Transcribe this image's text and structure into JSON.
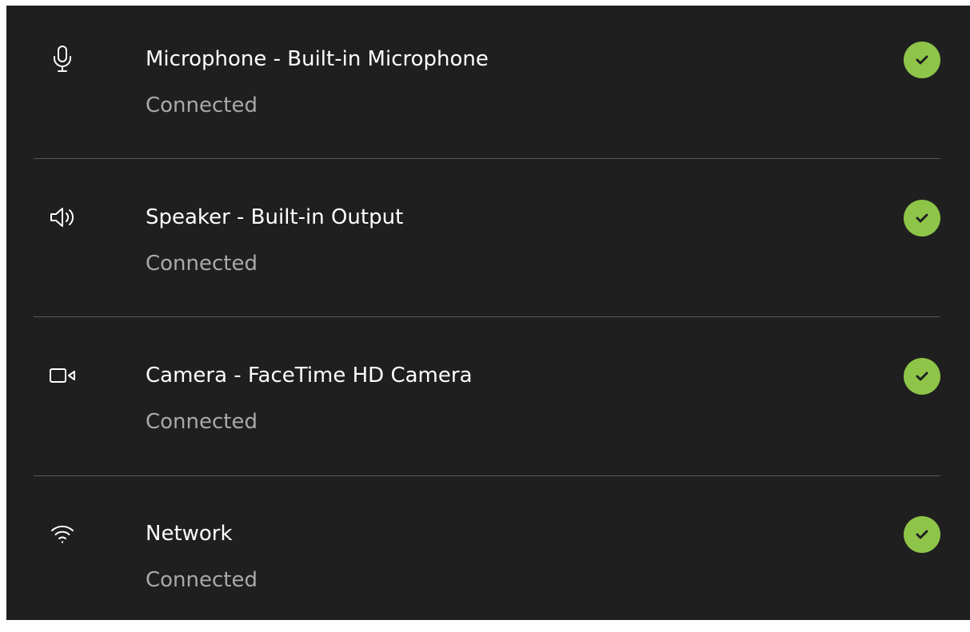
{
  "colors": {
    "panel_background": "#1f1f1f",
    "title_text": "#ffffff",
    "status_text": "#a9a9a9",
    "divider": "#5a5a5a",
    "success": "#8ec549",
    "check_mark": "#1f1f1f"
  },
  "devices": [
    {
      "icon": "microphone-icon",
      "title": "Microphone - Built-in Microphone",
      "status": "Connected",
      "status_icon": "check-circle-icon"
    },
    {
      "icon": "speaker-icon",
      "title": "Speaker - Built-in Output",
      "status": "Connected",
      "status_icon": "check-circle-icon"
    },
    {
      "icon": "camera-icon",
      "title": "Camera - FaceTime HD Camera",
      "status": "Connected",
      "status_icon": "check-circle-icon"
    },
    {
      "icon": "wifi-icon",
      "title": "Network",
      "status": "Connected",
      "status_icon": "check-circle-icon"
    }
  ]
}
